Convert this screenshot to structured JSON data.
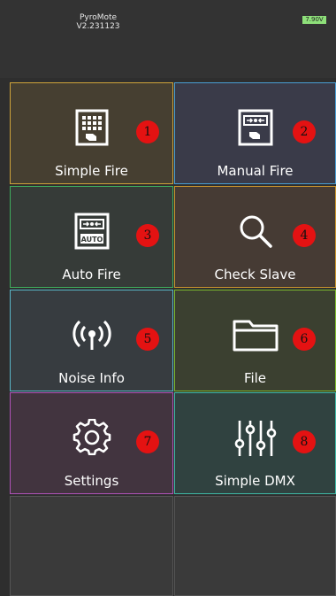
{
  "header": {
    "app_name": "PyroMote",
    "version": "V2.231123",
    "battery": "7.90V"
  },
  "tiles": [
    {
      "label": "Simple Fire",
      "badge": "1",
      "icon": "keypad-hand-icon",
      "color": "#d0a43a"
    },
    {
      "label": "Manual Fire",
      "badge": "2",
      "icon": "manual-fire-icon",
      "color": "#4a9fd4"
    },
    {
      "label": "Auto Fire",
      "badge": "3",
      "icon": "auto-fire-icon",
      "color": "#3fae5e"
    },
    {
      "label": "Check Slave",
      "badge": "4",
      "icon": "magnifier-icon",
      "color": "#c9952e"
    },
    {
      "label": "Noise Info",
      "badge": "5",
      "icon": "signal-antenna-icon",
      "color": "#5ab7c9"
    },
    {
      "label": "File",
      "badge": "6",
      "icon": "folder-icon",
      "color": "#7dbb2e"
    },
    {
      "label": "Settings",
      "badge": "7",
      "icon": "gear-icon",
      "color": "#b052b8"
    },
    {
      "label": "Simple DMX",
      "badge": "8",
      "icon": "sliders-icon",
      "color": "#3fb9a6"
    }
  ]
}
